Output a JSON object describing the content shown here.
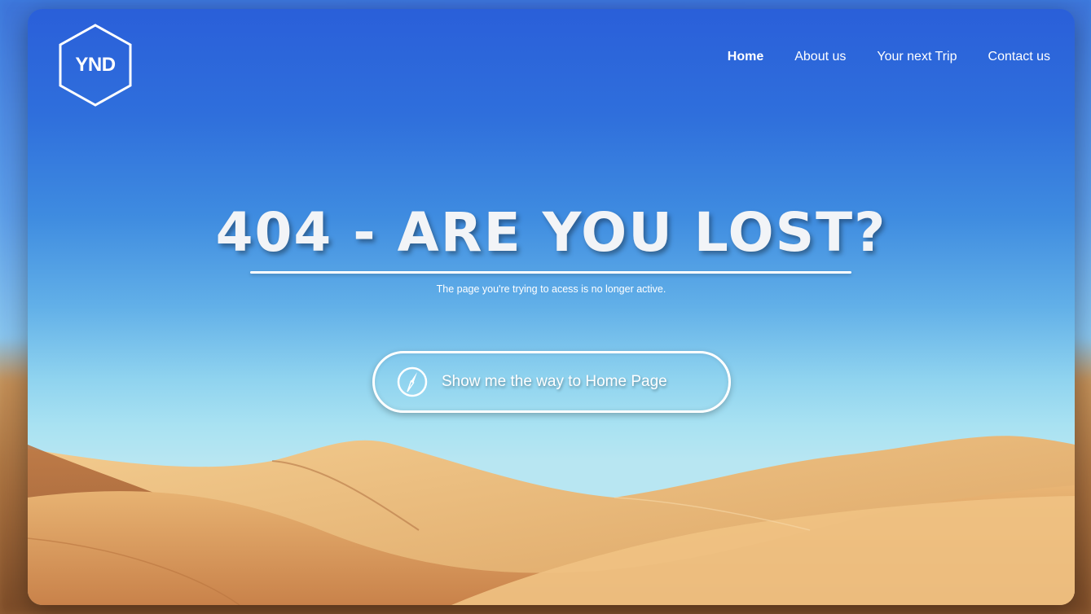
{
  "header": {
    "logo_text": "YND",
    "nav": [
      {
        "label": "Home",
        "active": true
      },
      {
        "label": "About us",
        "active": false
      },
      {
        "label": "Your next Trip",
        "active": false
      },
      {
        "label": "Contact us",
        "active": false
      }
    ]
  },
  "hero": {
    "title": "404 - ARE YOU LOST?",
    "subtitle": "The page you're trying to acess is no longer active.",
    "cta_label": "Show me the way to Home Page",
    "cta_icon": "compass-icon"
  },
  "colors": {
    "sky_top": "#2a5fd9",
    "sky_bottom": "#b8e6f2",
    "sand": "#e3a866",
    "text": "#ffffff"
  }
}
